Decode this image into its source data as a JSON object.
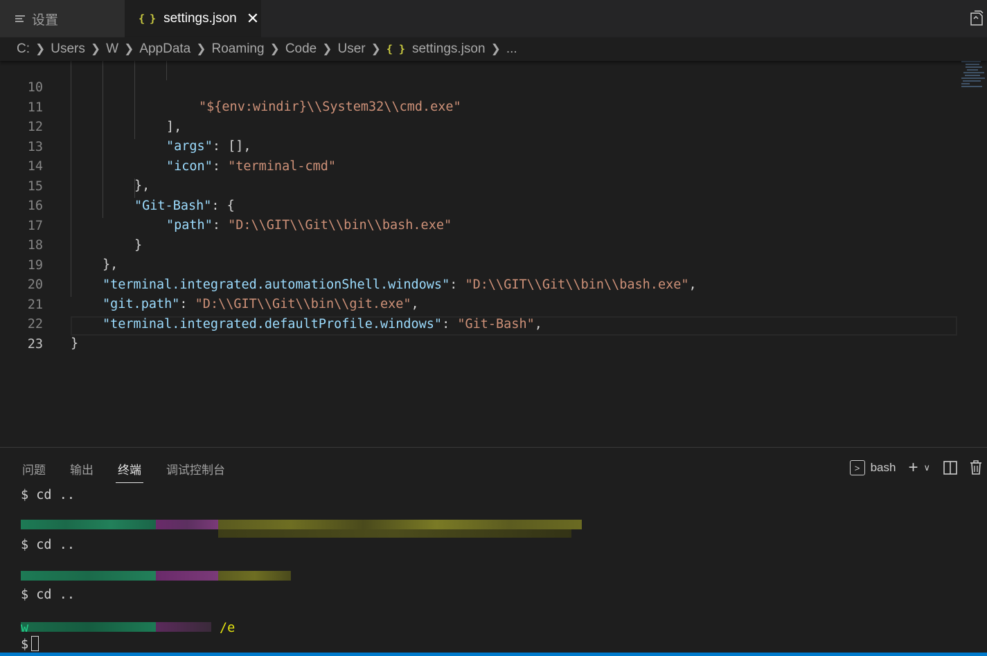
{
  "tabs": [
    {
      "label": "设置",
      "icon": "settings-list-icon",
      "active": false
    },
    {
      "label": "settings.json",
      "icon": "json-file-icon",
      "active": true,
      "close": "✕"
    }
  ],
  "breadcrumb": [
    "C:",
    "Users",
    "W",
    "AppData",
    "Roaming",
    "Code",
    "User",
    "settings.json",
    "..."
  ],
  "editor": {
    "lines": [
      {
        "n": "10",
        "text": "\"${env:windir}\\\\System32\\\\cmd.exe\""
      },
      {
        "n": "11",
        "text": "],"
      },
      {
        "n": "12",
        "key": "\"args\"",
        "rest": ": [],"
      },
      {
        "n": "13",
        "key": "\"icon\"",
        "rest": ": ",
        "value": "\"terminal-cmd\""
      },
      {
        "n": "14",
        "text": "},"
      },
      {
        "n": "15",
        "key": "\"Git-Bash\"",
        "rest": ": {"
      },
      {
        "n": "16",
        "key": "\"path\"",
        "rest": ": ",
        "value": "\"D:\\\\GIT\\\\Git\\\\bin\\\\bash.exe\""
      },
      {
        "n": "17",
        "text": "}"
      },
      {
        "n": "18",
        "text": "},"
      },
      {
        "n": "19",
        "key": "\"terminal.integrated.automationShell.windows\"",
        "rest": ": ",
        "value": "\"D:\\\\GIT\\\\Git\\\\bin\\\\bash.exe\"",
        "tail": ","
      },
      {
        "n": "20",
        "key": "\"git.path\"",
        "rest": ": ",
        "value": "\"D:\\\\GIT\\\\Git\\\\bin\\\\git.exe\"",
        "tail": ","
      },
      {
        "n": "21",
        "key": "\"terminal.integrated.defaultProfile.windows\"",
        "rest": ": ",
        "value": "\"Git-Bash\"",
        "tail": ","
      },
      {
        "n": "22",
        "text": "}"
      },
      {
        "n": "23",
        "text": ""
      }
    ],
    "active_line": "23"
  },
  "panel": {
    "tabs": [
      "问题",
      "输出",
      "终端",
      "调试控制台"
    ],
    "active_tab": "终端",
    "shell_label": "bash",
    "actions": [
      "new-terminal",
      "split-terminal",
      "kill-terminal"
    ]
  },
  "terminal": {
    "prompt": "$",
    "cmd1": " cd ..",
    "cmd2": " cd ..",
    "cmd3": " cd ..",
    "path_tail": "/e",
    "user_initial": "w"
  },
  "colors": {
    "accent": "#007acc",
    "json_icon": "#cbcb41",
    "string": "#ce9178",
    "key": "#9cdcfe"
  }
}
